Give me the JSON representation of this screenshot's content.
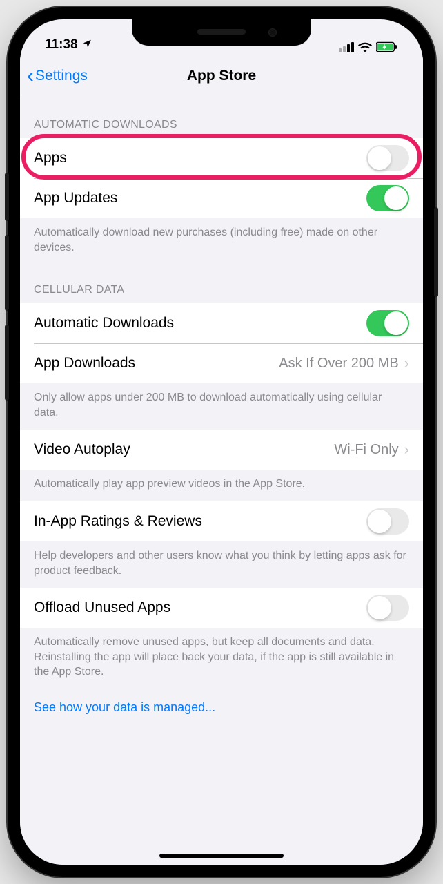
{
  "statusbar": {
    "time": "11:38"
  },
  "nav": {
    "back": "Settings",
    "title": "App Store"
  },
  "sections": {
    "auto_downloads": {
      "header": "AUTOMATIC DOWNLOADS",
      "apps_label": "Apps",
      "updates_label": "App Updates",
      "footer": "Automatically download new purchases (including free) made on other devices."
    },
    "cellular": {
      "header": "CELLULAR DATA",
      "auto_label": "Automatic Downloads",
      "appdl_label": "App Downloads",
      "appdl_value": "Ask If Over 200 MB",
      "footer": "Only allow apps under 200 MB to download automatically using cellular data."
    },
    "video": {
      "label": "Video Autoplay",
      "value": "Wi-Fi Only",
      "footer": "Automatically play app preview videos in the App Store."
    },
    "ratings": {
      "label": "In-App Ratings & Reviews",
      "footer": "Help developers and other users know what you think by letting apps ask for product feedback."
    },
    "offload": {
      "label": "Offload Unused Apps",
      "footer": "Automatically remove unused apps, but keep all documents and data. Reinstalling the app will place back your data, if the app is still available in the App Store."
    }
  },
  "link": "See how your data is managed...",
  "toggles": {
    "apps": false,
    "updates": true,
    "cell_auto": true,
    "ratings": false,
    "offload": false
  }
}
